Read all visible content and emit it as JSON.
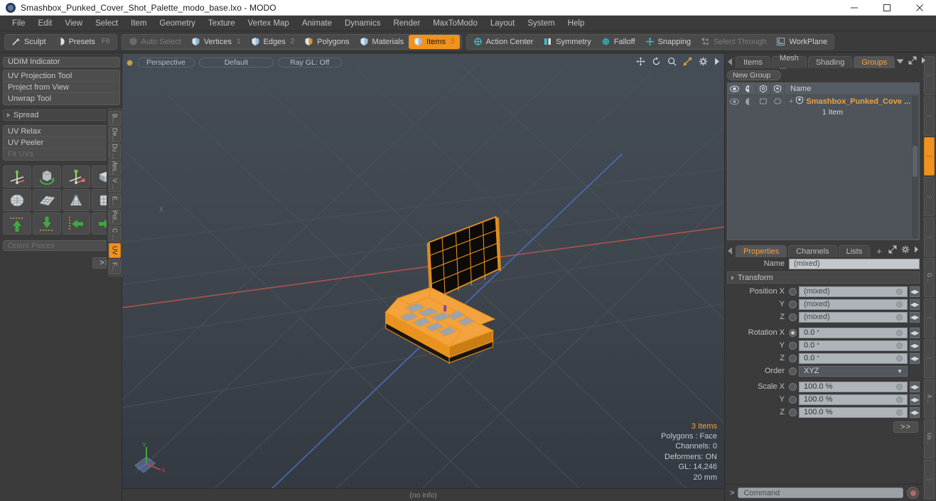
{
  "window": {
    "title": "Smashbox_Punked_Cover_Shot_Palette_modo_base.lxo - MODO",
    "logo": "modo-logo-icon",
    "minimize": "minimize-icon",
    "maximize": "maximize-icon",
    "close": "close-icon"
  },
  "menubar": {
    "items": [
      "File",
      "Edit",
      "View",
      "Select",
      "Item",
      "Geometry",
      "Texture",
      "Vertex Map",
      "Animate",
      "Dynamics",
      "Render",
      "MaxToModo",
      "Layout",
      "System",
      "Help"
    ]
  },
  "toolbar": {
    "groups": [
      {
        "buttons": [
          {
            "label": "Sculpt",
            "icon": "sculpt-brush-icon",
            "state": "normal",
            "key": "",
            "num": ""
          },
          {
            "label": "Presets",
            "icon": "presets-sphere-icon",
            "state": "normal",
            "key": "F6",
            "num": ""
          }
        ]
      },
      {
        "buttons": [
          {
            "label": "Auto Select",
            "icon": "auto-select-shield-icon",
            "state": "dim",
            "key": "",
            "num": ""
          },
          {
            "label": "Vertices",
            "icon": "vertices-shield-icon",
            "state": "normal",
            "key": "",
            "num": "1"
          },
          {
            "label": "Edges",
            "icon": "edges-shield-icon",
            "state": "normal",
            "key": "",
            "num": "2"
          },
          {
            "label": "Polygons",
            "icon": "polygons-shield-icon",
            "state": "normal",
            "key": "",
            "num": ""
          },
          {
            "label": "Materials",
            "icon": "materials-shield-icon",
            "state": "normal",
            "key": "",
            "num": ""
          },
          {
            "label": "Items",
            "icon": "items-shield-icon",
            "state": "active",
            "key": "",
            "num": "5"
          }
        ]
      },
      {
        "buttons": [
          {
            "label": "Action Center",
            "icon": "action-center-icon",
            "state": "normal",
            "key": "",
            "num": ""
          },
          {
            "label": "Symmetry",
            "icon": "symmetry-icon",
            "state": "normal",
            "key": "",
            "num": ""
          },
          {
            "label": "Falloff",
            "icon": "falloff-icon",
            "state": "normal",
            "key": "",
            "num": ""
          },
          {
            "label": "Snapping",
            "icon": "snapping-icon",
            "state": "normal",
            "key": "",
            "num": ""
          },
          {
            "label": "Select Through",
            "icon": "select-through-icon",
            "state": "dim",
            "key": "",
            "num": ""
          },
          {
            "label": "WorkPlane",
            "icon": "workplane-icon",
            "state": "normal",
            "key": "",
            "num": ""
          }
        ]
      }
    ]
  },
  "left_panel": {
    "udim_button": "UDIM Indicator",
    "tool_group_1": [
      {
        "label": "UV Projection Tool",
        "dim": false
      },
      {
        "label": "Project from View",
        "dim": false
      },
      {
        "label": "Unwrap Tool",
        "dim": false
      }
    ],
    "spread_header": "Spread",
    "tool_group_2": [
      {
        "label": "UV Relax",
        "dim": false
      },
      {
        "label": "UV Peeler",
        "dim": false
      },
      {
        "label": "Fit UVs",
        "dim": true
      }
    ],
    "icon_grid": [
      "move-uv-icon",
      "rotate-uv-icon",
      "scale-uv-icon",
      "flip-uv-icon",
      "sphere-unwrap-icon",
      "plane-unwrap-icon",
      "cone-unwrap-icon",
      "box-unwrap-icon",
      "move-up-icon",
      "move-down-icon",
      "move-left-icon",
      "move-right-icon"
    ],
    "orient_pieces": "Orient Pieces",
    "more_button": ">>",
    "vertical_tabs": [
      {
        "label": "B...",
        "active": false
      },
      {
        "label": "De...",
        "active": false
      },
      {
        "label": "Du ...",
        "active": false
      },
      {
        "label": "Mes...",
        "active": false
      },
      {
        "label": "V ...",
        "active": false
      },
      {
        "label": "E...",
        "active": false
      },
      {
        "label": "Pol...",
        "active": false
      },
      {
        "label": "C ...",
        "active": false
      },
      {
        "label": "UV",
        "active": true
      },
      {
        "label": "F...",
        "active": false
      }
    ]
  },
  "viewport": {
    "mode_button": "Perspective",
    "shading_button": "Default",
    "raygl_button": "Ray GL: Off",
    "tools": [
      "pan-icon",
      "rotate-icon",
      "zoom-icon",
      "fit-icon",
      "gear-icon",
      "chevron-right-icon"
    ],
    "stats": {
      "items": "3 Items",
      "polygons": "Polygons : Face",
      "channels": "Channels: 0",
      "deformers": "Deformers: ON",
      "gl": "GL: 14,246",
      "scale": "20 mm"
    },
    "axis_gizmo": "axis-gizmo-icon",
    "footer": "(no info)"
  },
  "right_panel": {
    "top_tabs": {
      "items": [
        "Items",
        "Mesh ...",
        "Shading",
        "Groups"
      ],
      "active": "Groups",
      "dropdown": "chevron-down-icon",
      "expand": "expand-icon",
      "arrow": "chevron-right-icon"
    },
    "new_group_button": "New Group",
    "group_list": {
      "column_icons": [
        "eye-icon",
        "render-icon",
        "wireframe-icon",
        "shaded-icon"
      ],
      "name_header": "Name",
      "rows": [
        {
          "expander": "+",
          "icon": "group-item-icon",
          "name": "Smashbox_Punked_Cove ...",
          "subtext": "1 Item"
        }
      ]
    },
    "bottom_tabs": {
      "items": [
        "Properties",
        "Channels",
        "Lists"
      ],
      "active": "Properties",
      "plus": "+",
      "expand": "expand-icon",
      "gear": "gear-icon",
      "arrow": "chevron-right-icon"
    },
    "properties": {
      "name_label": "Name",
      "name_value": "(mixed)",
      "transform_section": "Transform",
      "fields": [
        {
          "label": "Position X",
          "value": "(mixed)",
          "unit": "",
          "radio": false
        },
        {
          "label": "Y",
          "value": "(mixed)",
          "unit": "",
          "radio": false
        },
        {
          "label": "Z",
          "value": "(mixed)",
          "unit": "",
          "radio": false
        },
        {
          "label": "Rotation X",
          "value": "0.0",
          "unit": "°",
          "radio": true
        },
        {
          "label": "Y",
          "value": "0.0",
          "unit": "°",
          "radio": false
        },
        {
          "label": "Z",
          "value": "0.0",
          "unit": "°",
          "radio": false
        }
      ],
      "order_label": "Order",
      "order_value": "XYZ",
      "scale_fields": [
        {
          "label": "Scale X",
          "value": "100.0 %",
          "radio": false
        },
        {
          "label": "Y",
          "value": "100.0 %",
          "radio": false
        },
        {
          "label": "Z",
          "value": "100.0 %",
          "radio": false
        }
      ],
      "more_button": ">>"
    },
    "vertical_tabs": [
      {
        "label": "⋮",
        "active": false
      },
      {
        "label": "⋮",
        "active": false
      },
      {
        "label": "⋮",
        "active": true
      },
      {
        "label": "⋮",
        "active": false
      },
      {
        "label": "⋮",
        "active": false
      },
      {
        "label": "G ..",
        "active": false
      },
      {
        "label": "⋮",
        "active": false
      },
      {
        "label": "⋮",
        "active": false
      },
      {
        "label": "A ..",
        "active": false
      },
      {
        "label": "Us ..",
        "active": false
      },
      {
        "label": "⋮",
        "active": false
      }
    ]
  },
  "command_bar": {
    "arrow": ">",
    "placeholder": "Command",
    "record_button": "record-icon"
  },
  "colors": {
    "accent_orange": "#f0921e",
    "panel_bg": "#3b3b3b",
    "viewport_bg": "#3c434b",
    "field_bg": "#aeb4ba",
    "model_wire": "#f0951e"
  }
}
